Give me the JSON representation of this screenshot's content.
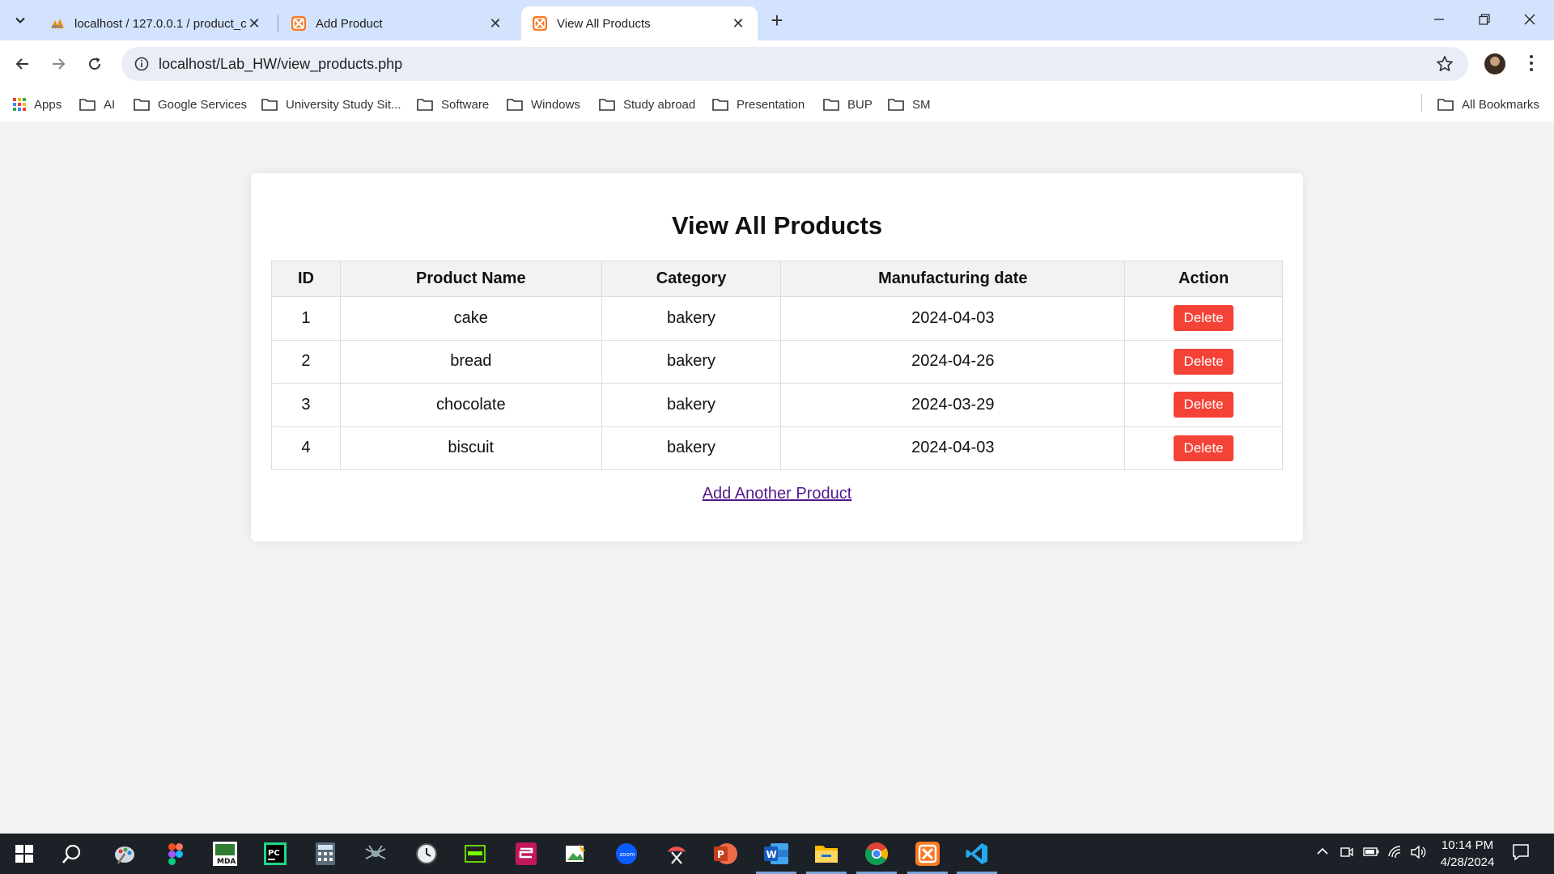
{
  "browser": {
    "tabs": [
      {
        "title": "localhost / 127.0.0.1 / product_c",
        "favicon": "phpmyadmin-icon"
      },
      {
        "title": "Add Product",
        "favicon": "xampp-icon"
      },
      {
        "title": "View All Products",
        "favicon": "xampp-icon",
        "active": true
      }
    ],
    "url": "localhost/Lab_HW/view_products.php",
    "bookmarks": [
      "Apps",
      "AI",
      "Google Services",
      "University Study Sit...",
      "Software",
      "Windows",
      "Study abroad",
      "Presentation",
      "BUP",
      "SM"
    ],
    "all_bookmarks": "All Bookmarks"
  },
  "page": {
    "heading": "View All Products",
    "columns": [
      "ID",
      "Product Name",
      "Category",
      "Manufacturing date",
      "Action"
    ],
    "rows": [
      {
        "id": "1",
        "name": "cake",
        "category": "bakery",
        "date": "2024-04-03",
        "action": "Delete"
      },
      {
        "id": "2",
        "name": "bread",
        "category": "bakery",
        "date": "2024-04-26",
        "action": "Delete"
      },
      {
        "id": "3",
        "name": "chocolate",
        "category": "bakery",
        "date": "2024-03-29",
        "action": "Delete"
      },
      {
        "id": "4",
        "name": "biscuit",
        "category": "bakery",
        "date": "2024-04-03",
        "action": "Delete"
      }
    ],
    "add_link": "Add Another Product"
  },
  "taskbar": {
    "time": "10:14 PM",
    "date": "4/28/2024"
  },
  "colors": {
    "delete_button": "#f44336",
    "tabstrip": "#d3e3fd",
    "link": "#551a8b"
  }
}
